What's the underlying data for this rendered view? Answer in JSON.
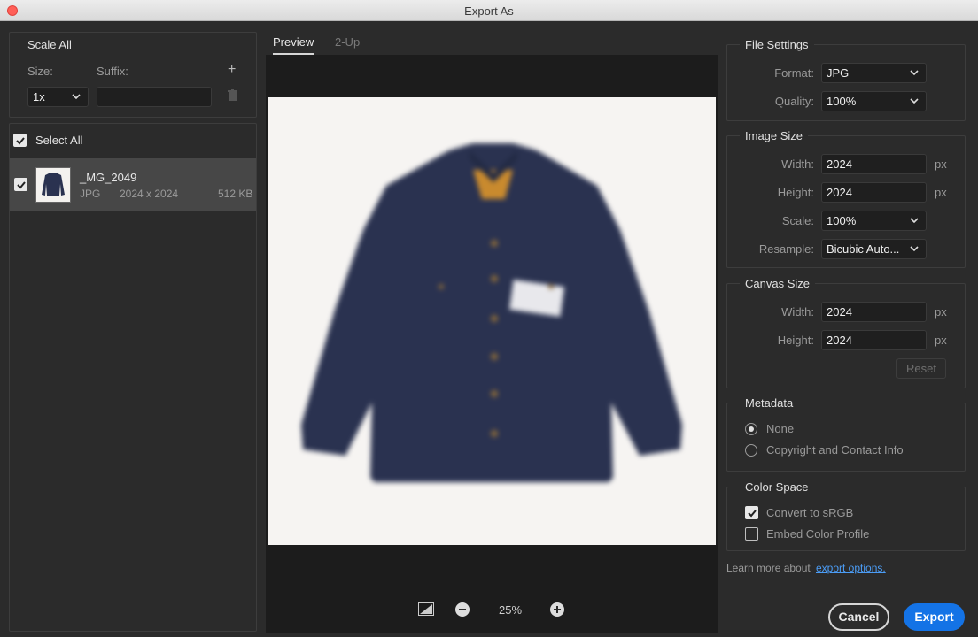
{
  "window": {
    "title": "Export As"
  },
  "left": {
    "scale_all": "Scale All",
    "size_label": "Size:",
    "suffix_label": "Suffix:",
    "size_value": "1x",
    "suffix_value": "",
    "select_all": "Select All",
    "file": {
      "name": "_MG_2049",
      "format": "JPG",
      "dims": "2024 x 2024",
      "size": "512 KB"
    }
  },
  "center": {
    "tabs": [
      "Preview",
      "2-Up"
    ],
    "zoom": "25%"
  },
  "file_settings": {
    "title": "File Settings",
    "format_label": "Format:",
    "format_value": "JPG",
    "quality_label": "Quality:",
    "quality_value": "100%"
  },
  "image_size": {
    "title": "Image Size",
    "width_label": "Width:",
    "width_value": "2024",
    "height_label": "Height:",
    "height_value": "2024",
    "scale_label": "Scale:",
    "scale_value": "100%",
    "resample_label": "Resample:",
    "resample_value": "Bicubic Auto...",
    "unit": "px"
  },
  "canvas_size": {
    "title": "Canvas Size",
    "width_label": "Width:",
    "width_value": "2024",
    "height_label": "Height:",
    "height_value": "2024",
    "unit": "px",
    "reset": "Reset"
  },
  "metadata": {
    "title": "Metadata",
    "options": [
      "None",
      "Copyright and Contact Info"
    ],
    "selected": "None"
  },
  "color_space": {
    "title": "Color Space",
    "convert": "Convert to sRGB",
    "embed": "Embed Color Profile"
  },
  "footer": {
    "learn_text": "Learn more about",
    "learn_link": "export options.",
    "cancel": "Cancel",
    "export": "Export"
  },
  "colors": {
    "accent": "#1473e6",
    "link": "#4b9cf5",
    "jacket": "#2a3250"
  }
}
